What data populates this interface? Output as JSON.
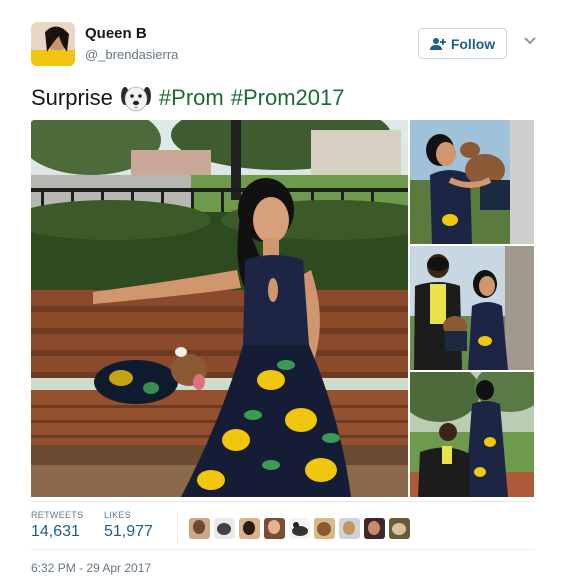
{
  "user": {
    "display_name": "Queen B",
    "handle": "@_brendasierra",
    "follow_label": "Follow"
  },
  "tweet": {
    "text": "Surprise",
    "emoji": "dog-face-icon",
    "hashtags": [
      "#Prom",
      "#Prom2017"
    ]
  },
  "stats": {
    "retweets_label": "RETWEETS",
    "retweets": "14,631",
    "likes_label": "LIKES",
    "likes": "51,977"
  },
  "likers_count": 9,
  "timestamp": "6:32 PM - 29 Apr 2017",
  "colors": {
    "link": "#1b5e8f",
    "hashtag": "#1b6b3a",
    "muted": "#657786"
  }
}
